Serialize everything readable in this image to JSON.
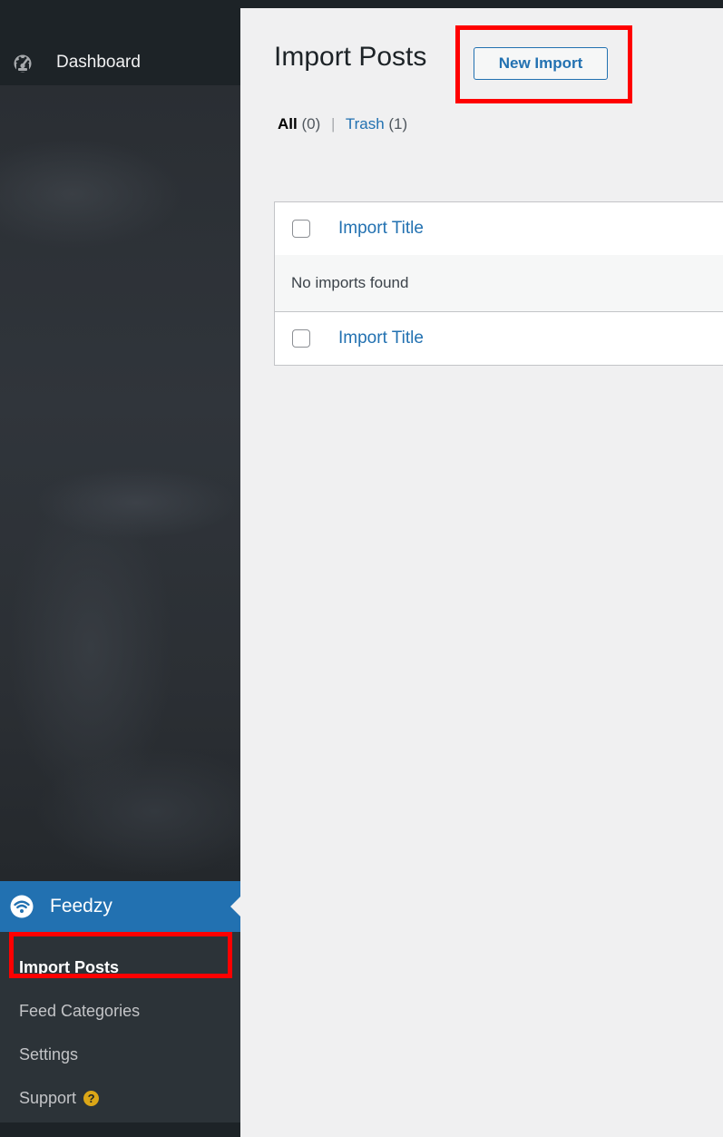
{
  "sidebar": {
    "dashboard_label": "Dashboard",
    "plugin_menu": {
      "label": "Feedzy",
      "icon": "wifi-icon"
    },
    "submenu": [
      {
        "label": "Import Posts",
        "current": true
      },
      {
        "label": "Feed Categories"
      },
      {
        "label": "Settings"
      },
      {
        "label": "Support",
        "badge": "?"
      }
    ]
  },
  "page": {
    "title": "Import Posts",
    "add_new_label": "New Import"
  },
  "views": {
    "all_label": "All",
    "all_count": "(0)",
    "separator": "|",
    "trash_label": "Trash",
    "trash_count": "(1)"
  },
  "table": {
    "column_title": "Import Title",
    "empty_message": "No imports found"
  },
  "colors": {
    "sidebar_bg": "#1d2327",
    "accent": "#2271b1",
    "highlight": "#ff0000",
    "page_bg": "#f0f0f1"
  }
}
